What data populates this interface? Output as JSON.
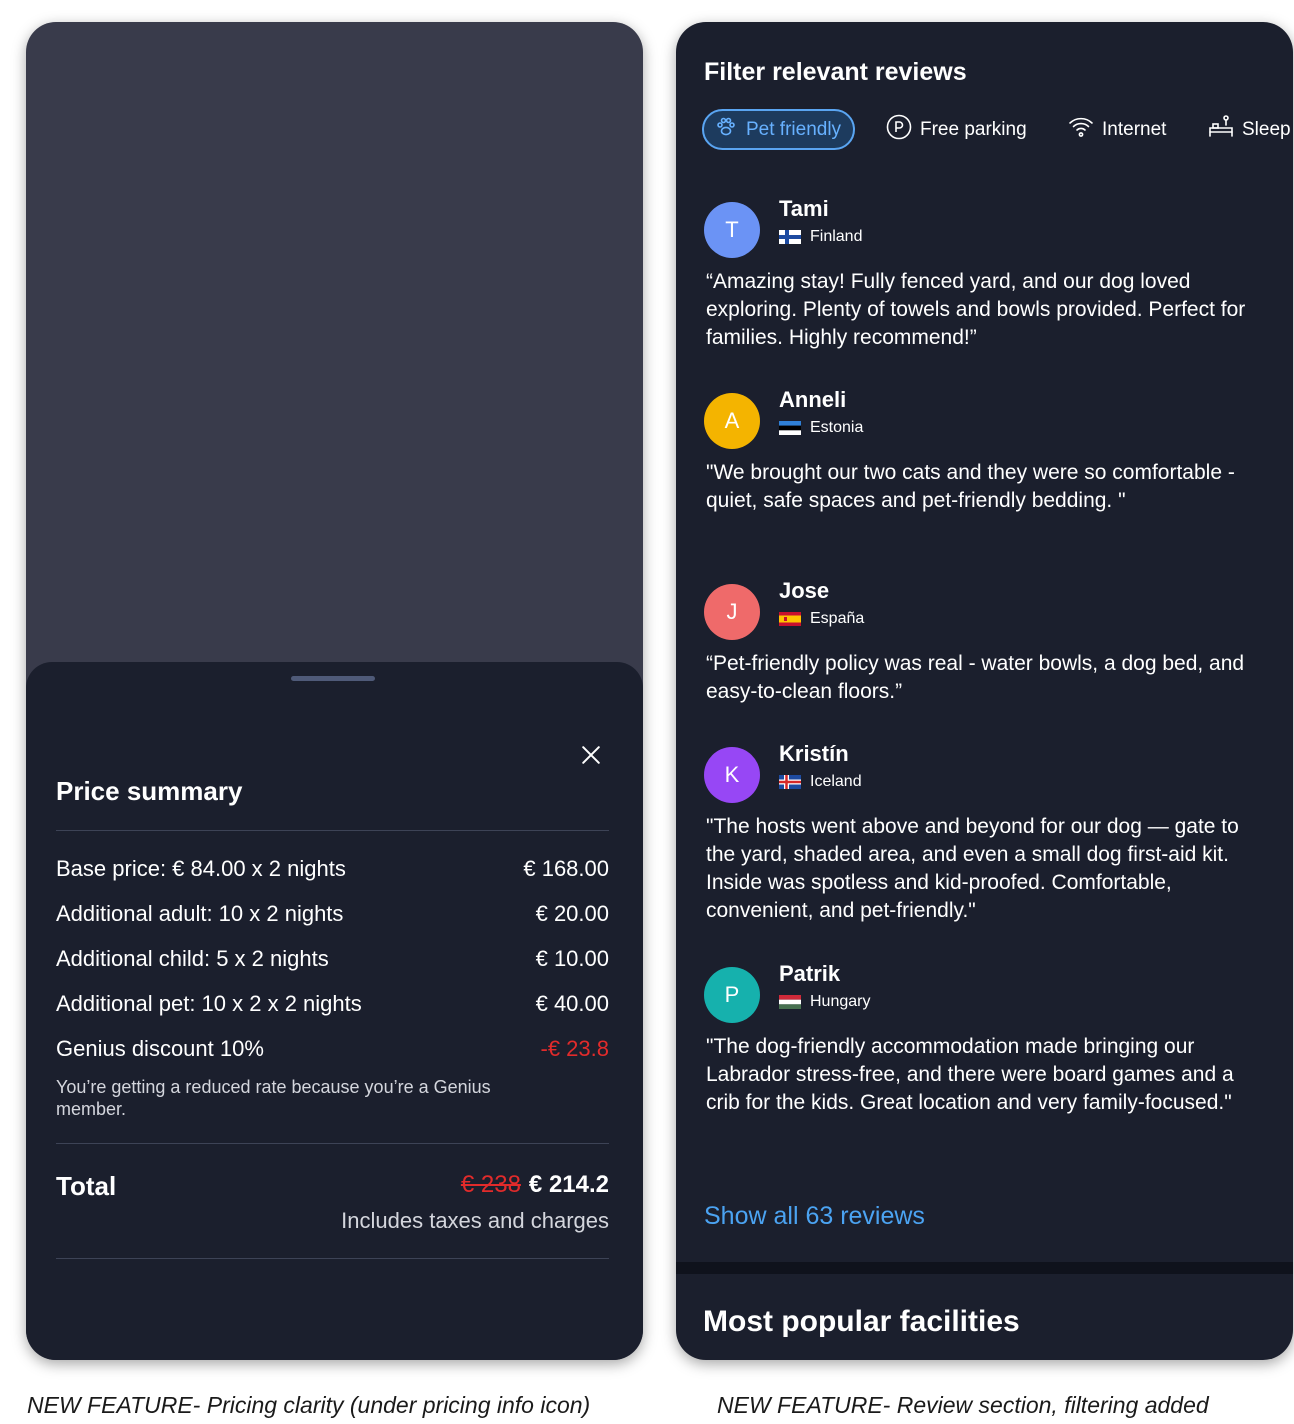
{
  "left_screen": {
    "sheet": {
      "title": "Price summary",
      "rows": [
        {
          "label": "Base price: € 84.00 x 2 nights",
          "value": "€ 168.00"
        },
        {
          "label": "Additional adult: 10 x 2 nights",
          "value": "€ 20.00"
        },
        {
          "label": "Additional child: 5 x 2 nights",
          "value": "€ 10.00"
        },
        {
          "label": "Additional pet: 10 x 2 x 2 nights",
          "value": "€ 40.00"
        },
        {
          "label": "Genius discount 10%",
          "value": "-€ 23.8"
        }
      ],
      "genius_note": "You’re getting a reduced rate because you’re a Genius member.",
      "total_label": "Total",
      "total_old": "€ 238",
      "total_new": "€ 214.2",
      "total_note": "Includes taxes and charges"
    }
  },
  "right_screen": {
    "filter_title": "Filter relevant reviews",
    "chips": [
      {
        "label": "Pet friendly",
        "icon": "paw-icon",
        "active": true
      },
      {
        "label": "Free parking",
        "icon": "parking-icon",
        "active": false
      },
      {
        "label": "Internet",
        "icon": "wifi-icon",
        "active": false
      },
      {
        "label": "Sleep",
        "icon": "bed-icon",
        "active": false
      }
    ],
    "reviews": [
      {
        "initial": "T",
        "name": "Tami",
        "country": "Finland",
        "avatar_color": "#6b93f5",
        "text": "“Amazing stay! Fully fenced yard, and our dog loved exploring. Plenty of towels and bowls provided. Perfect for families. Highly recommend!”"
      },
      {
        "initial": "A",
        "name": "Anneli",
        "country": "Estonia",
        "avatar_color": "#f4b400",
        "text": "\"We brought our two cats and they were so comfortable - quiet, safe spaces and pet-friendly bedding. \""
      },
      {
        "initial": "J",
        "name": "Jose",
        "country": "España",
        "avatar_color": "#ef6a6a",
        "text": "“Pet-friendly policy was real - water bowls, a dog bed, and easy-to-clean floors.”"
      },
      {
        "initial": "K",
        "name": "Kristín",
        "country": "Iceland",
        "avatar_color": "#9747f5",
        "text": "\"The hosts went above and beyond for our dog — gate to the yard, shaded area, and even a small dog first-aid kit. Inside was spotless and kid-proofed. Comfortable, convenient, and pet-friendly.\""
      },
      {
        "initial": "P",
        "name": "Patrik",
        "country": "Hungary",
        "avatar_color": "#16b1ad",
        "text": "\"The dog-friendly accommodation made bringing our Labrador stress-free, and there were board games and a crib for the kids. Great location and very family-focused.\""
      }
    ],
    "show_all": "Show all 63 reviews",
    "facilities_title": "Most popular facilities"
  },
  "captions": {
    "left": "NEW FEATURE- Pricing clarity (under pricing info icon)",
    "right": "NEW FEATURE- Review section, filtering added"
  }
}
